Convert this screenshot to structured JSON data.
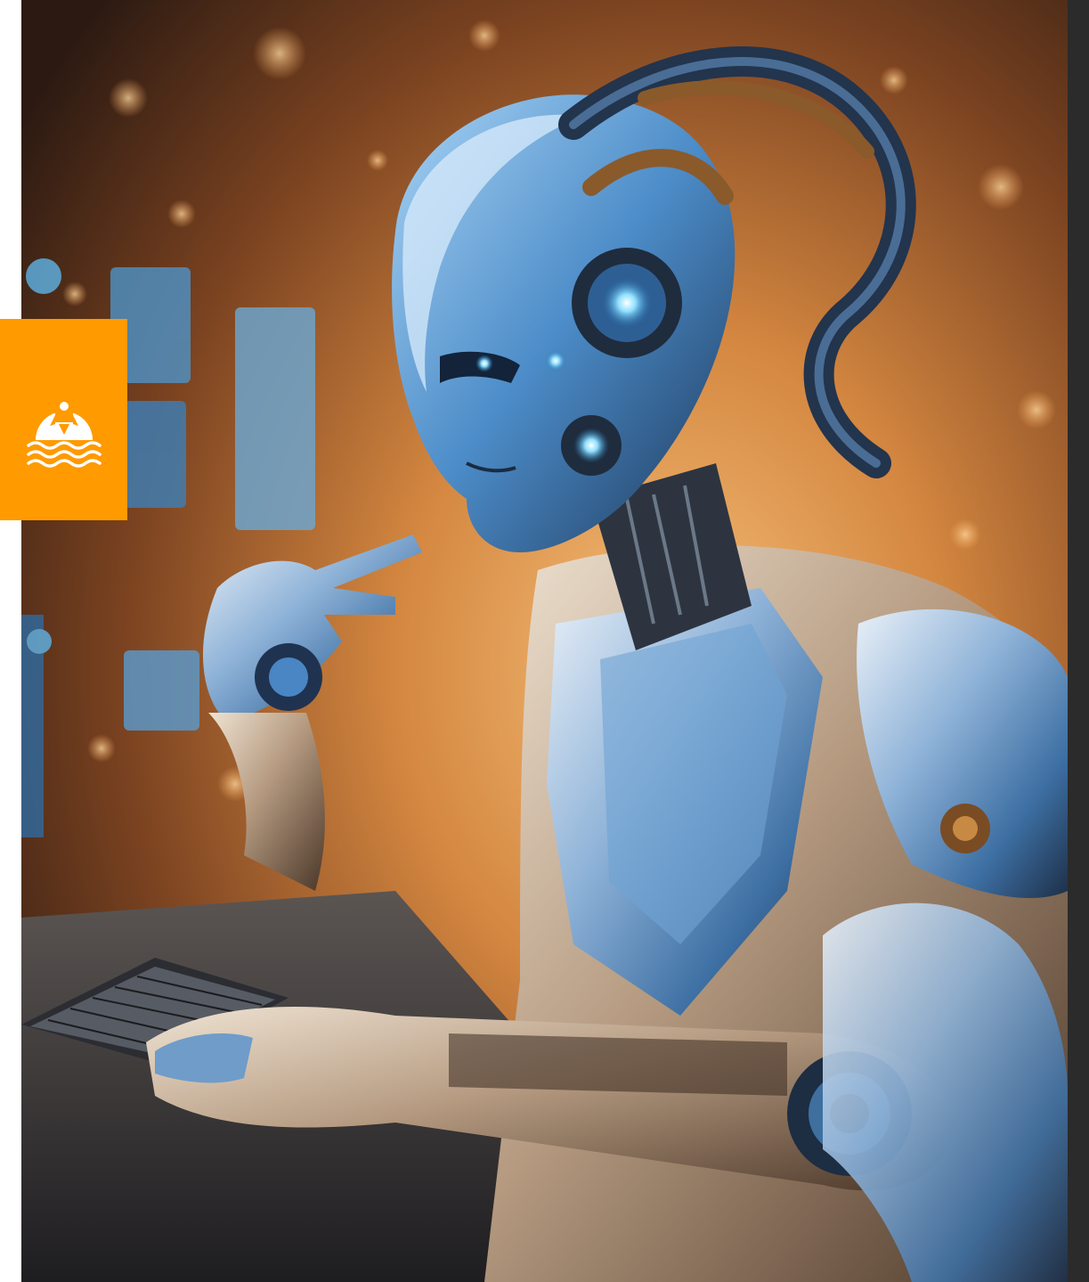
{
  "image": {
    "subject": "robot-at-keyboard",
    "palette": {
      "background_warm": "#b86a2e",
      "background_glow": "#f4b36a",
      "robot_chrome": "#c9d4e3",
      "robot_blue": "#3a7fc0",
      "robot_glow": "#7fd7ff",
      "desk_dark": "#2a2a2e",
      "bronze": "#8a5a2b"
    }
  },
  "logo": {
    "icon": "rocket-over-waves-icon",
    "color": "#ff9a00",
    "foreground": "#ffffff"
  },
  "frame": {
    "right_strip_color": "#2b2b2b"
  }
}
